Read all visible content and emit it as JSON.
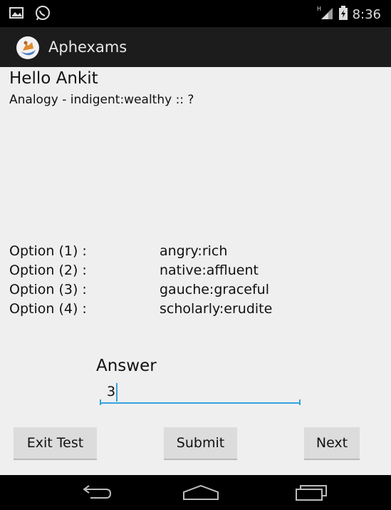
{
  "status_bar": {
    "time": "8:36",
    "network_type": "H",
    "icons": [
      "gallery-notification-icon",
      "whatsapp-notification-icon",
      "signal-icon",
      "battery-icon"
    ]
  },
  "app": {
    "title": "Aphexams"
  },
  "question": {
    "greeting": "Hello Ankit",
    "text": "Analogy - indigent:wealthy :: ?"
  },
  "options": [
    {
      "label": "Option (1) :",
      "value": "angry:rich"
    },
    {
      "label": "Option (2) :",
      "value": "native:affluent"
    },
    {
      "label": "Option (3) :",
      "value": "gauche:graceful"
    },
    {
      "label": "Option (4) :",
      "value": "scholarly:erudite"
    }
  ],
  "answer": {
    "label": "Answer",
    "value": "3"
  },
  "buttons": {
    "exit": "Exit Test",
    "submit": "Submit",
    "next": "Next"
  },
  "nav_bar": {
    "icons": [
      "back-icon",
      "home-icon",
      "recent-apps-icon"
    ]
  },
  "colors": {
    "accent": "#33a3dc",
    "action_bar": "#1c1c1c",
    "background": "#efefef",
    "button": "#dcdcdc"
  }
}
